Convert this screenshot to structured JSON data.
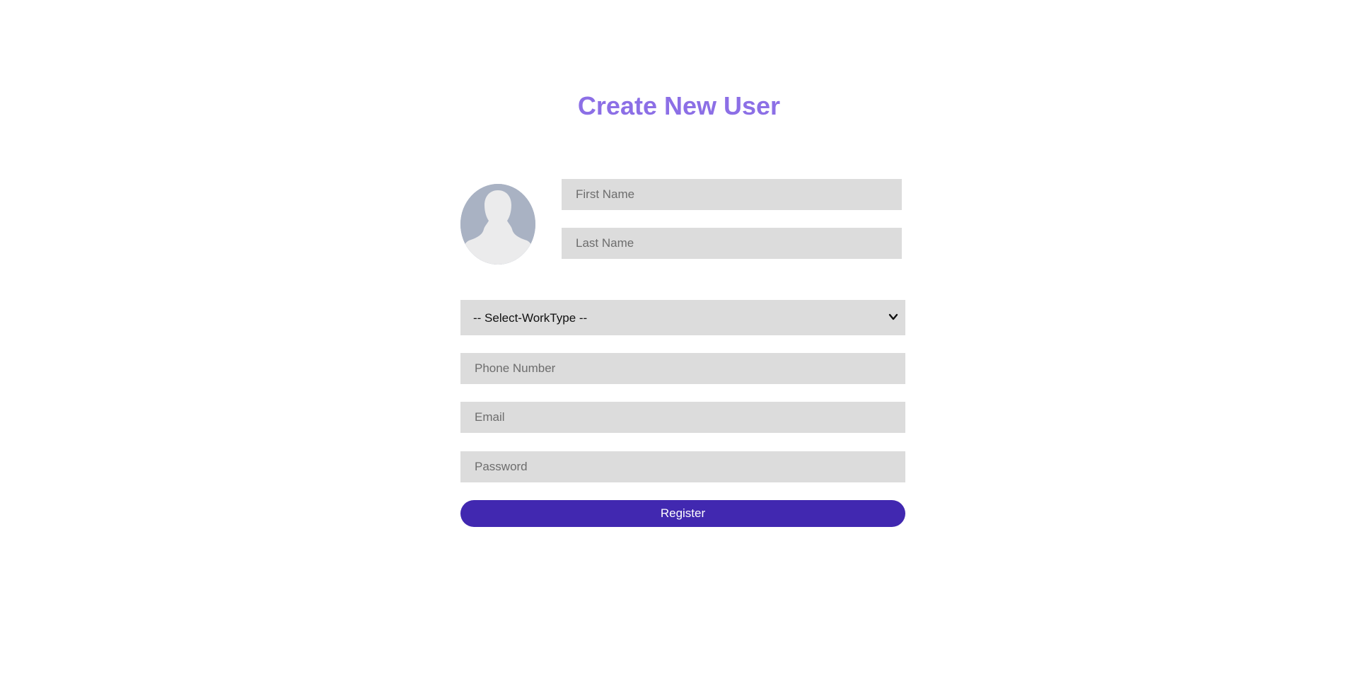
{
  "page": {
    "title": "Create New User"
  },
  "form": {
    "avatar_icon": "user-silhouette-icon",
    "first_name": {
      "placeholder": "First Name",
      "value": ""
    },
    "last_name": {
      "placeholder": "Last Name",
      "value": ""
    },
    "work_type": {
      "selected": "-- Select-WorkType --",
      "options": [
        "-- Select-WorkType --"
      ]
    },
    "phone": {
      "placeholder": "Phone Number",
      "value": ""
    },
    "email": {
      "placeholder": "Email",
      "value": ""
    },
    "password": {
      "placeholder": "Password",
      "value": ""
    },
    "register_label": "Register"
  },
  "colors": {
    "title": "#8c6fe6",
    "field_bg": "#dcdcdc",
    "button_bg": "#4128b0",
    "button_text": "#ffffff",
    "avatar_bg": "#a9b2c3",
    "avatar_figure": "#ebebec"
  }
}
